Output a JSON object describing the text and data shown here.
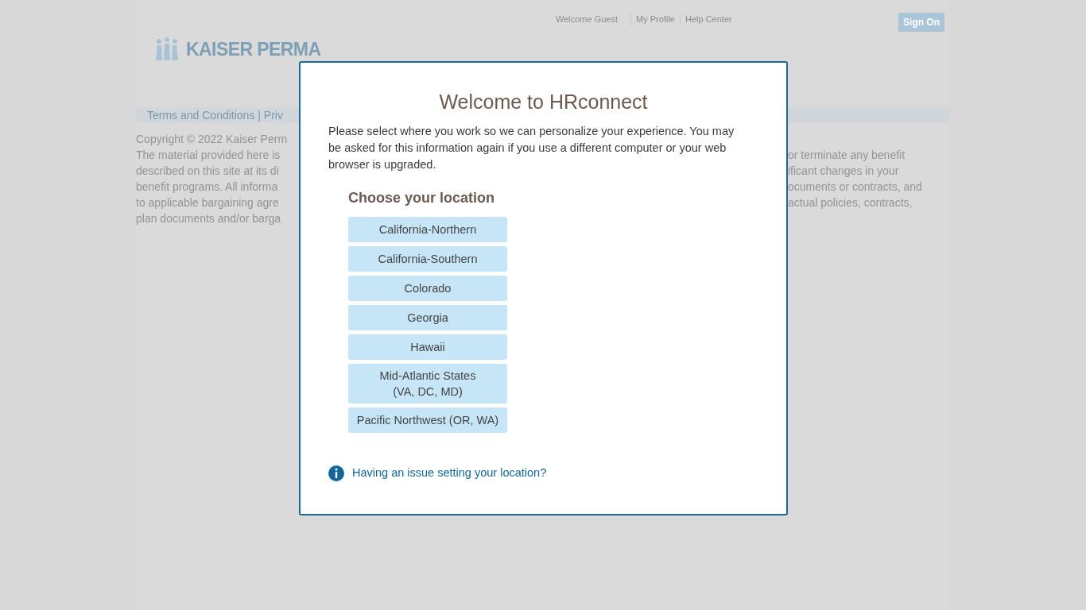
{
  "header": {
    "logo_text": "KAISER PERMA",
    "links": [
      "Welcome Guest",
      "My Profile",
      "Help Center"
    ],
    "sign_on": "Sign On"
  },
  "footer_bar": {
    "text": "Terms and Conditions | Priv"
  },
  "legal_lines": [
    {
      "left": "Copyright © 2022 Kaiser Perm"
    },
    {
      "left": "The material provided here is",
      "right": "or terminate any benefit"
    },
    {
      "left": "described on this site at its di",
      "right": "ificant changes in your"
    },
    {
      "left": "benefit programs. All informa",
      "right": "ocuments or contracts, and"
    },
    {
      "left": "to applicable bargaining agre",
      "right": "actual policies, contracts,"
    },
    {
      "left": "plan documents and/or barga"
    }
  ],
  "modal": {
    "title": "Welcome to HRconnect",
    "intro": "Please select where you work so we can personalize your experience. You may be asked for this information again if you use a different computer or your web browser is upgraded.",
    "heading": "Choose your location",
    "locations": [
      "California-Northern",
      "California-Southern",
      "Colorado",
      "Georgia",
      "Hawaii",
      "Mid-Atlantic States\n(VA, DC, MD)",
      "Pacific Northwest (OR, WA)"
    ],
    "help_link": "Having an issue setting your location?"
  }
}
